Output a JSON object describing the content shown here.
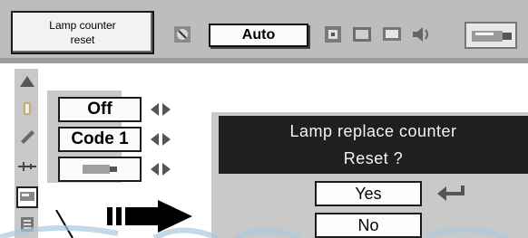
{
  "menu": {
    "title_line1": "Lamp counter",
    "title_line2": "reset",
    "current_mode": "Auto",
    "top_icons": [
      "image-adjust-icon",
      "screen-icon",
      "projector-icon",
      "monitor-icon",
      "sound-icon",
      "lamp-icon"
    ]
  },
  "side_menu": {
    "icons": [
      "triangle-up-icon",
      "power-icon",
      "pencil-icon",
      "plug-icon",
      "lamp-counter-icon",
      "filter-icon"
    ],
    "values": [
      "Off",
      "Code 1",
      ""
    ]
  },
  "dialog": {
    "title_line1": "Lamp replace counter",
    "title_line2": "Reset ?",
    "yes_label": "Yes",
    "no_label": "No"
  },
  "colors": {
    "menu_bg": "#bdbdbd",
    "dialog_title_bg": "#1f1f1f",
    "watermark": "#9fc3da"
  }
}
